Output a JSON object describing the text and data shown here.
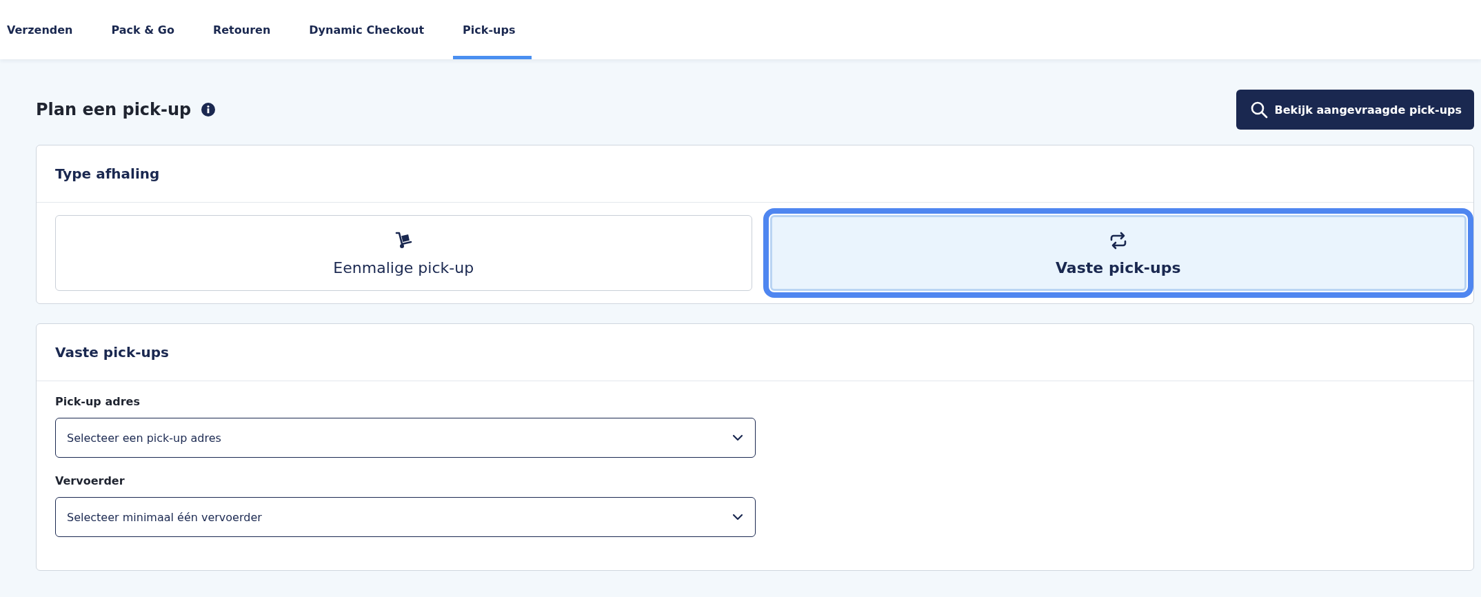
{
  "tabs": [
    {
      "label": "Verzenden",
      "selected": false
    },
    {
      "label": "Pack & Go",
      "selected": false
    },
    {
      "label": "Retouren",
      "selected": false
    },
    {
      "label": "Dynamic Checkout",
      "selected": false
    },
    {
      "label": "Pick-ups",
      "selected": true
    }
  ],
  "page": {
    "title": "Plan een pick-up",
    "action_button": "Bekijk aangevraagde pick-ups"
  },
  "pickup_type": {
    "heading": "Type afhaling",
    "options": [
      {
        "kind": "single",
        "label": "Eenmalige pick-up",
        "selected": false
      },
      {
        "kind": "recurring",
        "label": "Vaste pick-ups",
        "selected": true
      }
    ]
  },
  "recurring_form": {
    "heading": "Vaste pick-ups",
    "fields": [
      {
        "label": "Pick-up adres",
        "placeholder": "Selecteer een pick-up adres"
      },
      {
        "label": "Vervoerder",
        "placeholder": "Selecteer minimaal één vervoerder"
      }
    ]
  }
}
